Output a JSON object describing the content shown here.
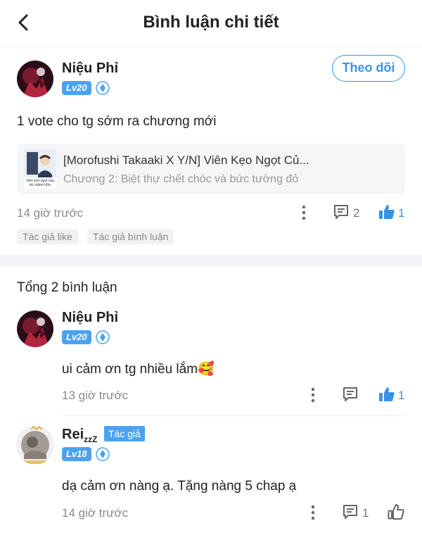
{
  "header": {
    "title": "Bình luận chi tiết"
  },
  "post": {
    "user": {
      "name": "Niệu Phỉ",
      "level": "Lv20"
    },
    "follow_label": "Theo dõi",
    "content": "1 vote cho tg sớm ra chương mới",
    "story": {
      "title": "[Morofushi Takaaki X Y/N] Viên Kẹo Ngọt Củ...",
      "chapter": "Chương 2: Biệt thự chết chóc và bức tường đỏ",
      "cover_caption": "Viên kẹo ngọt của kẻ chiếm hữu"
    },
    "time": "14 giờ trước",
    "reply_count": "2",
    "like_count": "1",
    "tags": [
      "Tác giả like",
      "Tác giả bình luận"
    ]
  },
  "replies": {
    "total_label": "Tổng 2 bình luận",
    "items": [
      {
        "name": "Niệu Phỉ",
        "level": "Lv20",
        "content": "ui cảm ơn tg nhiều lắm🥰",
        "time": "13 giờ trước",
        "like_count": "1"
      },
      {
        "name": "Rei",
        "name_suffix": "zzZ",
        "author_badge": "Tác giả",
        "level": "Lv18",
        "content": "dạ cảm ơn nàng ạ. Tặng nàng 5 chap ạ",
        "time": "14 giờ trước",
        "reply_count": "1"
      }
    ]
  },
  "colors": {
    "accent": "#3a92e6",
    "badge": "#4aa3f0",
    "muted": "#8a8a8a"
  }
}
